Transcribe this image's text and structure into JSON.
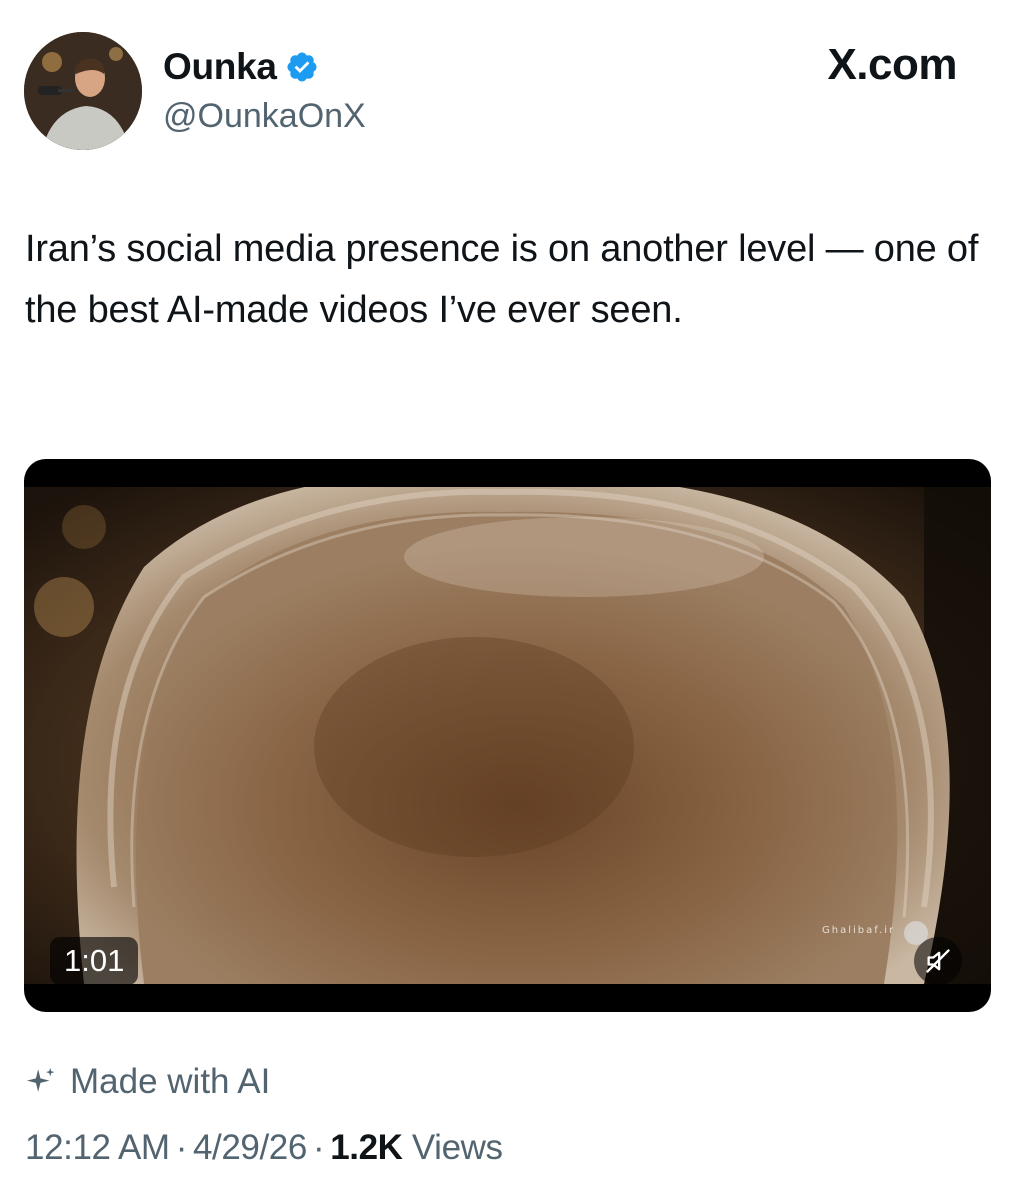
{
  "author": {
    "display_name": "Ounka",
    "handle": "@OunkaOnX",
    "verified": true,
    "verified_badge_color": "#1d9bf0"
  },
  "brand": {
    "site": "X.com"
  },
  "tweet": {
    "text": "Iran’s social media presence is on another level — one of the best AI-made videos I’ve ever seen."
  },
  "media": {
    "duration": "1:01",
    "muted": true,
    "watermark": "Ghalibaf.ir"
  },
  "ai_label": {
    "text": "Made with AI"
  },
  "meta": {
    "time": "12:12 AM",
    "separator": "·",
    "date": "4/29/26",
    "views_count": "1.2K",
    "views_label": "Views"
  },
  "colors": {
    "text_primary": "#0f1419",
    "text_secondary": "#536471"
  }
}
